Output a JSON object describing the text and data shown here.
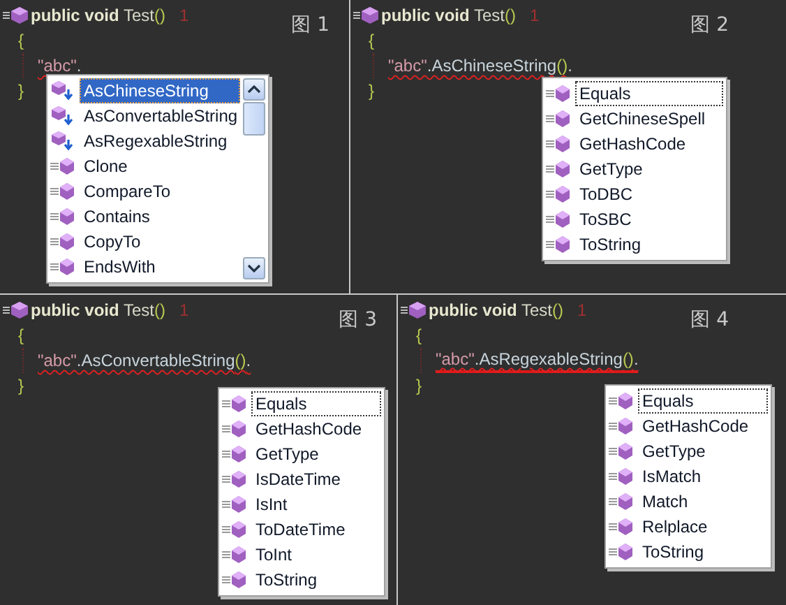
{
  "panels": [
    {
      "figure_label": "图 1",
      "signature": {
        "keywords": "public void",
        "name": "Test",
        "parens": "()",
        "ref_count": "1"
      },
      "open_brace": "{",
      "close_brace": "}",
      "error_line": false,
      "expression": [
        {
          "kind": "string",
          "text": "\"abc\""
        },
        {
          "kind": "plain",
          "text": "."
        }
      ],
      "popup": {
        "scrollable": true,
        "items": [
          {
            "kind": "extension",
            "label": "AsChineseString",
            "selected": true,
            "focused": true
          },
          {
            "kind": "extension",
            "label": "AsConvertableString",
            "selected": false,
            "focused": false
          },
          {
            "kind": "extension",
            "label": "AsRegexableString",
            "selected": false,
            "focused": false
          },
          {
            "kind": "method",
            "label": "Clone",
            "selected": false,
            "focused": false
          },
          {
            "kind": "method",
            "label": "CompareTo",
            "selected": false,
            "focused": false
          },
          {
            "kind": "method",
            "label": "Contains",
            "selected": false,
            "focused": false
          },
          {
            "kind": "method",
            "label": "CopyTo",
            "selected": false,
            "focused": false
          },
          {
            "kind": "method",
            "label": "EndsWith",
            "selected": false,
            "focused": false
          }
        ]
      }
    },
    {
      "figure_label": "图 2",
      "signature": {
        "keywords": "public void",
        "name": "Test",
        "parens": "()",
        "ref_count": "1"
      },
      "open_brace": "{",
      "close_brace": "}",
      "error_line": false,
      "expression": [
        {
          "kind": "string",
          "text": "\"abc\""
        },
        {
          "kind": "plain",
          "text": ".AsChineseString"
        },
        {
          "kind": "paren",
          "text": "()"
        },
        {
          "kind": "plain",
          "text": "."
        }
      ],
      "popup": {
        "scrollable": false,
        "items": [
          {
            "kind": "method",
            "label": "Equals",
            "selected": false,
            "focused": true
          },
          {
            "kind": "method",
            "label": "GetChineseSpell",
            "selected": false,
            "focused": false
          },
          {
            "kind": "method",
            "label": "GetHashCode",
            "selected": false,
            "focused": false
          },
          {
            "kind": "method",
            "label": "GetType",
            "selected": false,
            "focused": false
          },
          {
            "kind": "method",
            "label": "ToDBC",
            "selected": false,
            "focused": false
          },
          {
            "kind": "method",
            "label": "ToSBC",
            "selected": false,
            "focused": false
          },
          {
            "kind": "method",
            "label": "ToString",
            "selected": false,
            "focused": false
          }
        ]
      }
    },
    {
      "figure_label": "图 3",
      "signature": {
        "keywords": "public void",
        "name": "Test",
        "parens": "()",
        "ref_count": "1"
      },
      "open_brace": "{",
      "close_brace": "}",
      "error_line": false,
      "expression": [
        {
          "kind": "string",
          "text": "\"abc\""
        },
        {
          "kind": "plain",
          "text": ".AsConvertableString"
        },
        {
          "kind": "paren",
          "text": "()"
        },
        {
          "kind": "plain",
          "text": "."
        }
      ],
      "popup": {
        "scrollable": false,
        "items": [
          {
            "kind": "method",
            "label": "Equals",
            "selected": false,
            "focused": true
          },
          {
            "kind": "method",
            "label": "GetHashCode",
            "selected": false,
            "focused": false
          },
          {
            "kind": "method",
            "label": "GetType",
            "selected": false,
            "focused": false
          },
          {
            "kind": "method",
            "label": "IsDateTime",
            "selected": false,
            "focused": false
          },
          {
            "kind": "method",
            "label": "IsInt",
            "selected": false,
            "focused": false
          },
          {
            "kind": "method",
            "label": "ToDateTime",
            "selected": false,
            "focused": false
          },
          {
            "kind": "method",
            "label": "ToInt",
            "selected": false,
            "focused": false
          },
          {
            "kind": "method",
            "label": "ToString",
            "selected": false,
            "focused": false
          }
        ]
      }
    },
    {
      "figure_label": "图 4",
      "signature": {
        "keywords": "public void",
        "name": "Test",
        "parens": "()",
        "ref_count": "1"
      },
      "open_brace": "{",
      "close_brace": "}",
      "error_line": true,
      "expression": [
        {
          "kind": "string",
          "text": "\"abc\""
        },
        {
          "kind": "plain",
          "text": ".AsRegexableString"
        },
        {
          "kind": "paren",
          "text": "()"
        },
        {
          "kind": "plain",
          "text": "."
        }
      ],
      "popup": {
        "scrollable": false,
        "items": [
          {
            "kind": "method",
            "label": "Equals",
            "selected": false,
            "focused": true
          },
          {
            "kind": "method",
            "label": "GetHashCode",
            "selected": false,
            "focused": false
          },
          {
            "kind": "method",
            "label": "GetType",
            "selected": false,
            "focused": false
          },
          {
            "kind": "method",
            "label": "IsMatch",
            "selected": false,
            "focused": false
          },
          {
            "kind": "method",
            "label": "Match",
            "selected": false,
            "focused": false
          },
          {
            "kind": "method",
            "label": "Relplace",
            "selected": false,
            "focused": false
          },
          {
            "kind": "method",
            "label": "ToString",
            "selected": false,
            "focused": false
          }
        ]
      }
    }
  ]
}
